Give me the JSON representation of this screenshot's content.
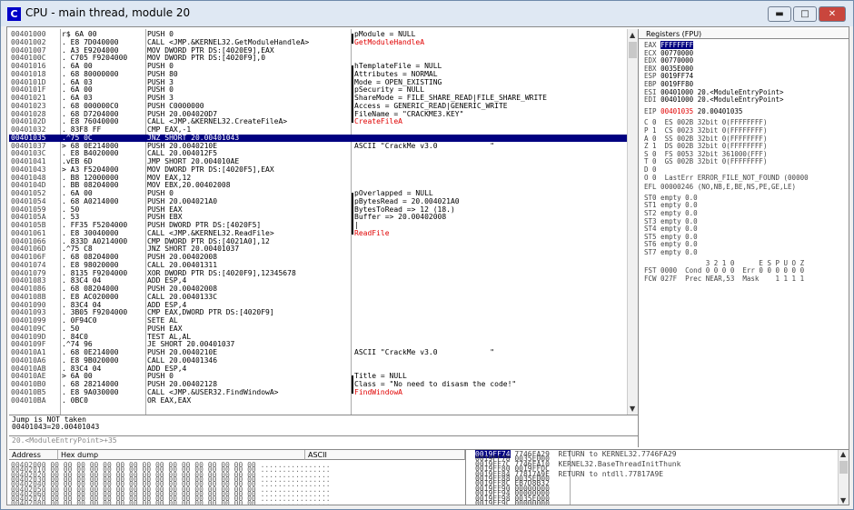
{
  "window": {
    "title": "CPU - main thread, module 20",
    "app_icon": "C",
    "minimize": "▬",
    "maximize": "□",
    "close": "✕"
  },
  "cpu": {
    "rows": [
      {
        "addr": "00401000",
        "hex": "r$ 6A 00",
        "dis": "PUSH 0",
        "com": "pModule = NULL",
        "br": "top"
      },
      {
        "addr": "00401002",
        "hex": ". E8 7D040000",
        "dis": "CALL <JMP.&KERNEL32.GetModuleHandleA>",
        "com": "GetModuleHandleA",
        "red": true,
        "br": "end"
      },
      {
        "addr": "00401007",
        "hex": ". A3 E9204000",
        "dis": "MOV DWORD PTR DS:[4020E9],EAX",
        "com": ""
      },
      {
        "addr": "0040100C",
        "hex": ". C705 F9204000",
        "dis": "MOV DWORD PTR DS:[4020F9],0",
        "com": ""
      },
      {
        "addr": "00401016",
        "hex": ". 6A 00",
        "dis": "PUSH 0",
        "com": "hTemplateFile = NULL",
        "br": "top"
      },
      {
        "addr": "00401018",
        "hex": ". 68 80000000",
        "dis": "PUSH 80",
        "com": "Attributes = NORMAL",
        "br": "mid"
      },
      {
        "addr": "0040101D",
        "hex": ". 6A 03",
        "dis": "PUSH 3",
        "com": "Mode = OPEN_EXISTING",
        "br": "mid"
      },
      {
        "addr": "0040101F",
        "hex": ". 6A 00",
        "dis": "PUSH 0",
        "com": "pSecurity = NULL",
        "br": "mid"
      },
      {
        "addr": "00401021",
        "hex": ". 6A 03",
        "dis": "PUSH 3",
        "com": "ShareMode = FILE_SHARE_READ|FILE_SHARE_WRITE",
        "br": "mid"
      },
      {
        "addr": "00401023",
        "hex": ". 68 000000C0",
        "dis": "PUSH C0000000",
        "com": "Access = GENERIC_READ|GENERIC_WRITE",
        "br": "mid"
      },
      {
        "addr": "00401028",
        "hex": ". 68 D7204000",
        "dis": "PUSH 20.004020D7",
        "com": "FileName = \"CRACKME3.KEY\"",
        "br": "mid"
      },
      {
        "addr": "0040102D",
        "hex": ". E8 76040000",
        "dis": "CALL <JMP.&KERNEL32.CreateFileA>",
        "com": "CreateFileA",
        "red": true,
        "br": "end"
      },
      {
        "addr": "00401032",
        "hex": ". 83F8 FF",
        "dis": "CMP EAX,-1",
        "com": ""
      },
      {
        "addr": "00401035",
        "hex": ".^75 0C",
        "dis": "JNZ SHORT 20.00401043",
        "com": "",
        "sel": true
      },
      {
        "addr": "00401037",
        "hex": "> 68 0E214000",
        "dis": "PUSH 20.0040210E",
        "com": "ASCII \"CrackMe v3.0            \""
      },
      {
        "addr": "0040103C",
        "hex": ". E8 B4020000",
        "dis": "CALL 20.004012F5",
        "com": ""
      },
      {
        "addr": "00401041",
        "hex": ".vEB 6D",
        "dis": "JMP SHORT 20.004010AE",
        "com": ""
      },
      {
        "addr": "00401043",
        "hex": "> A3 F5204000",
        "dis": "MOV DWORD PTR DS:[4020F5],EAX",
        "com": ""
      },
      {
        "addr": "00401048",
        "hex": ". B8 12000000",
        "dis": "MOV EAX,12",
        "com": ""
      },
      {
        "addr": "0040104D",
        "hex": ". BB 08204000",
        "dis": "MOV EBX,20.00402008",
        "com": ""
      },
      {
        "addr": "00401052",
        "hex": ". 6A 00",
        "dis": "PUSH 0",
        "com": "pOverlapped = NULL",
        "br": "top"
      },
      {
        "addr": "00401054",
        "hex": ". 68 A0214000",
        "dis": "PUSH 20.004021A0",
        "com": "pBytesRead = 20.004021A0",
        "br": "mid"
      },
      {
        "addr": "00401059",
        "hex": ". 50",
        "dis": "PUSH EAX",
        "com": "BytesToRead => 12 (18.)",
        "br": "mid"
      },
      {
        "addr": "0040105A",
        "hex": ". 53",
        "dis": "PUSH EBX",
        "com": "Buffer => 20.00402008",
        "br": "mid"
      },
      {
        "addr": "0040105B",
        "hex": ". FF35 F5204000",
        "dis": "PUSH DWORD PTR DS:[4020F5]",
        "com": "|",
        "br": "mid"
      },
      {
        "addr": "00401061",
        "hex": ". E8 30040000",
        "dis": "CALL <JMP.&KERNEL32.ReadFile>",
        "com": "ReadFile",
        "red": true,
        "br": "end"
      },
      {
        "addr": "00401066",
        "hex": ". 833D A0214000",
        "dis": "CMP DWORD PTR DS:[4021A0],12",
        "com": ""
      },
      {
        "addr": "0040106D",
        "hex": ".^75 C8",
        "dis": "JNZ SHORT 20.00401037",
        "com": ""
      },
      {
        "addr": "0040106F",
        "hex": ". 68 08204000",
        "dis": "PUSH 20.00402008",
        "com": ""
      },
      {
        "addr": "00401074",
        "hex": ". E8 98020000",
        "dis": "CALL 20.00401311",
        "com": ""
      },
      {
        "addr": "00401079",
        "hex": ". 8135 F9204000",
        "dis": "XOR DWORD PTR DS:[4020F9],12345678",
        "com": ""
      },
      {
        "addr": "00401083",
        "hex": ". 83C4 04",
        "dis": "ADD ESP,4",
        "com": ""
      },
      {
        "addr": "00401086",
        "hex": ". 68 08204000",
        "dis": "PUSH 20.00402008",
        "com": ""
      },
      {
        "addr": "0040108B",
        "hex": ". E8 AC020000",
        "dis": "CALL 20.0040133C",
        "com": ""
      },
      {
        "addr": "00401090",
        "hex": ". 83C4 04",
        "dis": "ADD ESP,4",
        "com": ""
      },
      {
        "addr": "00401093",
        "hex": ". 3B05 F9204000",
        "dis": "CMP EAX,DWORD PTR DS:[4020F9]",
        "com": ""
      },
      {
        "addr": "00401099",
        "hex": ". 0F94C0",
        "dis": "SETE AL",
        "com": ""
      },
      {
        "addr": "0040109C",
        "hex": ". 50",
        "dis": "PUSH EAX",
        "com": ""
      },
      {
        "addr": "0040109D",
        "hex": ". 84C0",
        "dis": "TEST AL,AL",
        "com": ""
      },
      {
        "addr": "0040109F",
        "hex": ".^74 96",
        "dis": "JE SHORT 20.00401037",
        "com": ""
      },
      {
        "addr": "004010A1",
        "hex": ". 68 0E214000",
        "dis": "PUSH 20.0040210E",
        "com": "ASCII \"CrackMe v3.0            \""
      },
      {
        "addr": "004010A6",
        "hex": ". E8 9B020000",
        "dis": "CALL 20.00401346",
        "com": ""
      },
      {
        "addr": "004010AB",
        "hex": ". 83C4 04",
        "dis": "ADD ESP,4",
        "com": ""
      },
      {
        "addr": "004010AE",
        "hex": "> 6A 00",
        "dis": "PUSH 0",
        "com": "Title = NULL",
        "br": "top"
      },
      {
        "addr": "004010B0",
        "hex": ". 68 28214000",
        "dis": "PUSH 20.00402128",
        "com": "Class = \"No need to disasm the code!\"",
        "br": "mid"
      },
      {
        "addr": "004010B5",
        "hex": ". E8 9A030000",
        "dis": "CALL <JMP.&USER32.FindWindowA>",
        "com": "FindWindowA",
        "red": true,
        "br": "end"
      },
      {
        "addr": "004010BA",
        "hex": ". 0BC0",
        "dis": "OR EAX,EAX",
        "com": ""
      }
    ]
  },
  "info": {
    "line1": "Jump is NOT taken",
    "line2": "00401043=20.00401043",
    "line3": "20.<ModuleEntryPoint>+35"
  },
  "registers": {
    "header": "Registers (FPU)",
    "gp": [
      {
        "name": "EAX",
        "val": "FFFFFFFF",
        "sel": true
      },
      {
        "name": "ECX",
        "val": "00770000"
      },
      {
        "name": "EDX",
        "val": "00770000"
      },
      {
        "name": "EBX",
        "val": "0035E000"
      },
      {
        "name": "ESP",
        "val": "0019FF74"
      },
      {
        "name": "EBP",
        "val": "0019FF80"
      },
      {
        "name": "ESI",
        "val": "00401000 20.<ModuleEntryPoint>"
      },
      {
        "name": "EDI",
        "val": "00401000 20.<ModuleEntryPoint>"
      }
    ],
    "eip": {
      "name": "EIP",
      "val": "00401035",
      "extra": "20.00401035"
    },
    "flags": [
      "C 0  ES 002B 32bit 0(FFFFFFFF)",
      "P 1  CS 0023 32bit 0(FFFFFFFF)",
      "A 0  SS 002B 32bit 0(FFFFFFFF)",
      "Z 1  DS 002B 32bit 0(FFFFFFFF)",
      "S 0  FS 0053 32bit 361000(FFF)",
      "T 0  GS 002B 32bit 0(FFFFFFFF)",
      "D 0",
      "O 0  LastErr ERROR_FILE_NOT_FOUND (00000"
    ],
    "efl": "EFL 00000246 (NO,NB,E,BE,NS,PE,GE,LE)",
    "fpu": [
      "ST0 empty 0.0",
      "ST1 empty 0.0",
      "ST2 empty 0.0",
      "ST3 empty 0.0",
      "ST4 empty 0.0",
      "ST5 empty 0.0",
      "ST6 empty 0.0",
      "ST7 empty 0.0"
    ],
    "fst_head": "               3 2 1 0      E S P U O Z",
    "fst": "FST 0000  Cond 0 0 0 0  Err 0 0 0 0 0 0",
    "fcw": "FCW 027F  Prec NEAR,53  Mask    1 1 1 1"
  },
  "dump": {
    "col_address": "Address",
    "col_hex": "Hex dump",
    "col_ascii": "ASCII",
    "rows": [
      {
        "addr": "00402000",
        "hex": "00 00 00 00 00 00 00 00 00 00 00 00 00 00 00 00",
        "ascii": "................"
      },
      {
        "addr": "00402010",
        "hex": "00 00 00 00 00 00 00 00 00 00 00 00 00 00 00 00",
        "ascii": "................"
      },
      {
        "addr": "00402020",
        "hex": "00 00 00 00 00 00 00 00 00 00 00 00 00 00 00 00",
        "ascii": "................"
      },
      {
        "addr": "00402030",
        "hex": "00 00 00 00 00 00 00 00 00 00 00 00 00 00 00 00",
        "ascii": "................"
      },
      {
        "addr": "00402040",
        "hex": "00 00 00 00 00 00 00 00 00 00 00 00 00 00 00 00",
        "ascii": "................"
      },
      {
        "addr": "00402050",
        "hex": "00 00 00 00 00 00 00 00 00 00 00 00 00 00 00 00",
        "ascii": "................"
      },
      {
        "addr": "00402060",
        "hex": "00 00 00 00 00 00 00 00 00 00 00 00 00 00 00 00",
        "ascii": "................"
      },
      {
        "addr": "00402070",
        "hex": "00 00 00 00 00 00 00 00 00 00 00 00 00 00 00 00",
        "ascii": "................"
      },
      {
        "addr": "00402080",
        "hex": "00 00 00 00 00 00 00 00 00 00 00 00 00 00 00 00",
        "ascii": "................"
      }
    ]
  },
  "stack": {
    "rows": [
      {
        "addr": "0019FF74",
        "val": "7746FA29",
        "com": "RETURN to KERNEL32.7746FA29",
        "sel": true
      },
      {
        "addr": "0019FF78",
        "val": "0035E000",
        "com": ""
      },
      {
        "addr": "0019FF7C",
        "val": "7746FA10",
        "com": "KERNEL32.BaseThreadInitThunk"
      },
      {
        "addr": "0019FF80",
        "val": "0019FFDC",
        "com": ""
      },
      {
        "addr": "0019FF84",
        "val": "77817A9E",
        "com": "RETURN to ntdll.77817A9E"
      },
      {
        "addr": "0019FF88",
        "val": "0035E000",
        "com": ""
      },
      {
        "addr": "0019FF8C",
        "val": "EB7D8B32",
        "com": ""
      },
      {
        "addr": "0019FF90",
        "val": "00000000",
        "com": ""
      },
      {
        "addr": "0019FF94",
        "val": "00000000",
        "com": ""
      },
      {
        "addr": "0019FF98",
        "val": "0035E000",
        "com": ""
      },
      {
        "addr": "0019FF9C",
        "val": "00000000",
        "com": ""
      }
    ]
  }
}
